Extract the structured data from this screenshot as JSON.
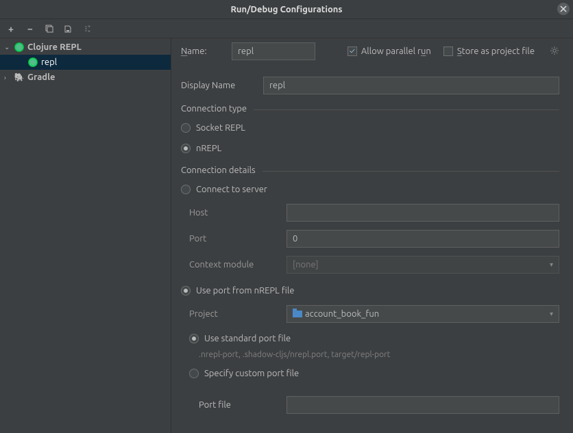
{
  "title": "Run/Debug Configurations",
  "tree": {
    "items": [
      {
        "label": "Clojure REPL"
      },
      {
        "label": "repl"
      },
      {
        "label": "Gradle"
      }
    ]
  },
  "topbar": {
    "name_label": "Name:",
    "name_value": "repl",
    "allow_parallel": "Allow parallel run",
    "store_as_file": "Store as project file"
  },
  "form": {
    "display_name_label": "Display Name",
    "display_name_value": "repl",
    "connection_type_label": "Connection type",
    "radio_socket": "Socket REPL",
    "radio_nrepl": "nREPL",
    "connection_details_label": "Connection details",
    "radio_connect": "Connect to server",
    "host_label": "Host",
    "host_value": "",
    "port_label": "Port",
    "port_value": "0",
    "context_label": "Context module",
    "context_value": "[none]",
    "radio_use_port_file": "Use port from nREPL file",
    "project_label": "Project",
    "project_value": "account_book_fun",
    "radio_std_port": "Use standard port file",
    "std_port_hint": ".nrepl-port, .shadow-cljs/nrepl.port, target/repl-port",
    "radio_custom_port": "Specify custom port file",
    "port_file_label": "Port file",
    "port_file_value": ""
  }
}
